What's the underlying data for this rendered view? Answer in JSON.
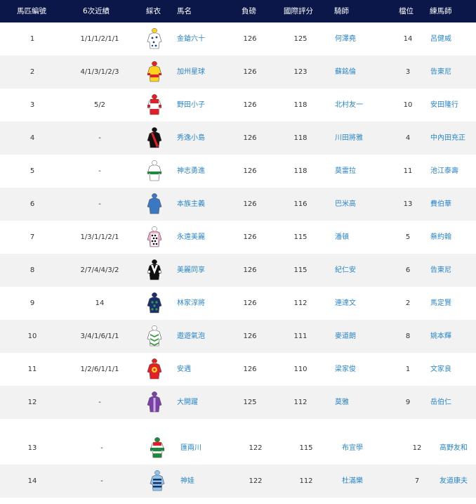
{
  "columns": {
    "no": "馬匹編號",
    "form": "6次近績",
    "silks": "綵衣",
    "horse": "馬名",
    "weight": "負磅",
    "rating": "國際評分",
    "jockey": "騎師",
    "draw": "檔位",
    "trainer": "練馬師"
  },
  "rows": [
    {
      "no": "1",
      "form": "1/1/1/2/1/1",
      "horse": "金鎗六十",
      "weight": "126",
      "rating": "125",
      "jockey": "何澤堯",
      "draw": "14",
      "trainer": "呂健威",
      "silk": "white-blue-dots"
    },
    {
      "no": "2",
      "form": "4/1/3/1/2/3",
      "horse": "加州星球",
      "weight": "126",
      "rating": "123",
      "jockey": "蘇銘倫",
      "draw": "3",
      "trainer": "告東尼",
      "silk": "yellow-red"
    },
    {
      "no": "3",
      "form": "5/2",
      "horse": "野田小子",
      "weight": "126",
      "rating": "118",
      "jockey": "北村友一",
      "draw": "10",
      "trainer": "安田隆行",
      "silk": "red-white-bands"
    },
    {
      "no": "4",
      "form": "-",
      "horse": "秀逸小島",
      "weight": "126",
      "rating": "118",
      "jockey": "川田將雅",
      "draw": "4",
      "trainer": "中內田充正",
      "silk": "black-red-sash"
    },
    {
      "no": "5",
      "form": "-",
      "horse": "神志勇進",
      "weight": "126",
      "rating": "118",
      "jockey": "莫雷拉",
      "draw": "11",
      "trainer": "池江泰壽",
      "silk": "white-green-band"
    },
    {
      "no": "6",
      "form": "-",
      "horse": "本族主義",
      "weight": "126",
      "rating": "116",
      "jockey": "巴米高",
      "draw": "13",
      "trainer": "費伯華",
      "silk": "blue"
    },
    {
      "no": "7",
      "form": "1/3/1/1/2/1",
      "horse": "永遠美麗",
      "weight": "126",
      "rating": "115",
      "jockey": "潘頓",
      "draw": "5",
      "trainer": "蔡約翰",
      "silk": "pink-black-dots"
    },
    {
      "no": "8",
      "form": "2/7/4/4/3/2",
      "horse": "美麗同享",
      "weight": "126",
      "rating": "115",
      "jockey": "紀仁安",
      "draw": "6",
      "trainer": "告東尼",
      "silk": "black-white-v"
    },
    {
      "no": "9",
      "form": "14",
      "horse": "林家淳將",
      "weight": "126",
      "rating": "112",
      "jockey": "連達文",
      "draw": "2",
      "trainer": "馬定賢",
      "silk": "navy-green"
    },
    {
      "no": "10",
      "form": "3/4/1/6/1/1",
      "horse": "遨遊氣泡",
      "weight": "126",
      "rating": "111",
      "jockey": "麥道朗",
      "draw": "8",
      "trainer": "姚本輝",
      "silk": "white-green-chevrons"
    },
    {
      "no": "11",
      "form": "1/2/6/1/1/1",
      "horse": "安遇",
      "weight": "126",
      "rating": "110",
      "jockey": "梁家俊",
      "draw": "1",
      "trainer": "文家良",
      "silk": "red-yellow-disc"
    },
    {
      "no": "12",
      "form": "-",
      "horse": "大開躍",
      "weight": "125",
      "rating": "112",
      "jockey": "莫雅",
      "draw": "9",
      "trainer": "岳伯仁",
      "silk": "purple"
    },
    {
      "no": "13",
      "form": "-",
      "horse": "匯兩川",
      "weight": "122",
      "rating": "115",
      "jockey": "布宜學",
      "draw": "12",
      "trainer": "高野友和",
      "silk": "green-red-white"
    },
    {
      "no": "14",
      "form": "-",
      "horse": "神娃",
      "weight": "122",
      "rating": "112",
      "jockey": "杜滿樂",
      "draw": "7",
      "trainer": "友道康夫",
      "silk": "lightblue-navy"
    }
  ]
}
